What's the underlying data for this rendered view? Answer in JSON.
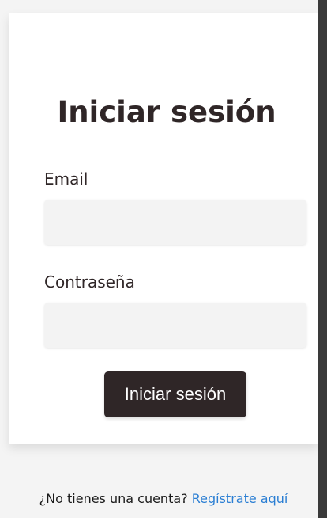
{
  "login": {
    "title": "Iniciar sesión",
    "email_label": "Email",
    "email_value": "",
    "password_label": "Contraseña",
    "password_value": "",
    "submit_label": "Iniciar sesión"
  },
  "footer": {
    "prompt": "¿No tienes una cuenta?",
    "register_link": "Regístrate aquí"
  },
  "colors": {
    "primary": "#2f2627",
    "link": "#2a7ed3",
    "page_background": "#f4f4f4",
    "card_background": "#ffffff",
    "field_background": "#f3f3f3"
  }
}
